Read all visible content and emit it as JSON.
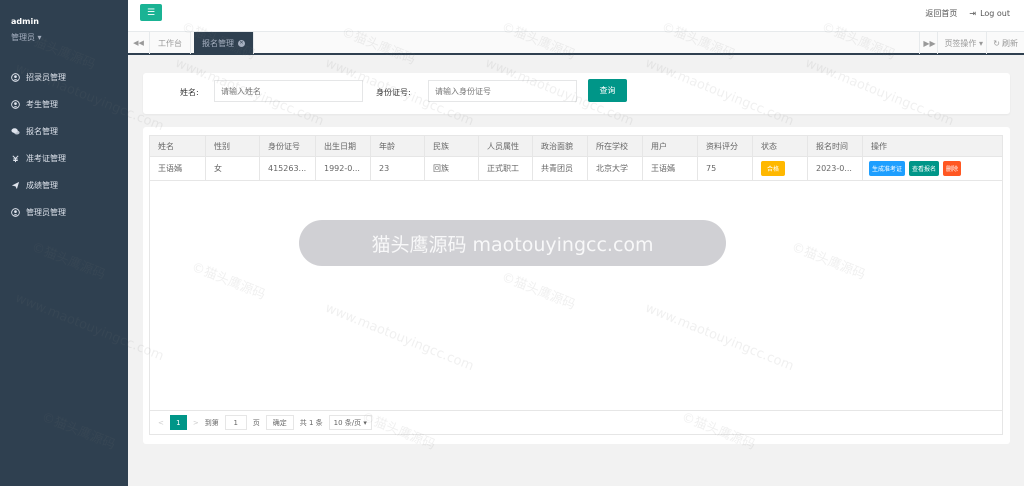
{
  "sidebar": {
    "user_name": "admin",
    "user_role": "管理员 ▾",
    "items": [
      {
        "label": "招录员管理",
        "icon": "user-circle-icon"
      },
      {
        "label": "考生管理",
        "icon": "user-circle-icon"
      },
      {
        "label": "报名管理",
        "icon": "comments-icon"
      },
      {
        "label": "准考证管理",
        "icon": "money-icon"
      },
      {
        "label": "成绩管理",
        "icon": "send-icon"
      },
      {
        "label": "管理员管理",
        "icon": "user-circle-icon"
      }
    ]
  },
  "topbar": {
    "menu_icon": "hamburger-icon",
    "home_label": "返回首页",
    "logout_label": "Log out"
  },
  "tabs": {
    "items": [
      {
        "label": "工作台"
      },
      {
        "label": "报名管理"
      }
    ],
    "page_ops_label": "页签操作 ▾",
    "refresh_label": "刷新"
  },
  "search": {
    "name_label": "姓名:",
    "name_placeholder": "请输入姓名",
    "id_label": "身份证号:",
    "id_placeholder": "请输入身份证号",
    "button_label": "查询"
  },
  "table": {
    "headers": [
      "姓名",
      "性别",
      "身份证号",
      "出生日期",
      "年龄",
      "民族",
      "人员属性",
      "政治面貌",
      "所在学校",
      "用户",
      "资料评分",
      "状态",
      "报名时间",
      "操作"
    ],
    "rows": [
      {
        "cells": [
          "王语嫣",
          "女",
          "415263...",
          "1992-0...",
          "23",
          "回族",
          "正式职工",
          "共青团员",
          "北京大学",
          "王语嫣",
          "75"
        ],
        "status": "合格",
        "time": "2023-0...",
        "ops": [
          "生成准考证",
          "查看报名",
          "删除"
        ]
      }
    ]
  },
  "pager": {
    "prev": "<",
    "current": "1",
    "next": ">",
    "goto_label": "到第",
    "goto_value": "1",
    "page_unit": "页",
    "confirm": "确定",
    "total": "共 1 条",
    "per_page": "10 条/页 ▾"
  },
  "watermark": {
    "main": "猫头鹰源码 maotouyingcc.com",
    "repeat_a": "©猫头鹰源码",
    "repeat_b": "www.maotouyingcc.com"
  },
  "colors": {
    "sidebar_bg": "#2f4050",
    "accent": "#1ab394",
    "primary_btn": "#009688",
    "badge_yellow": "#ffb800",
    "op_blue": "#1e9fff",
    "op_red": "#ff5722"
  }
}
